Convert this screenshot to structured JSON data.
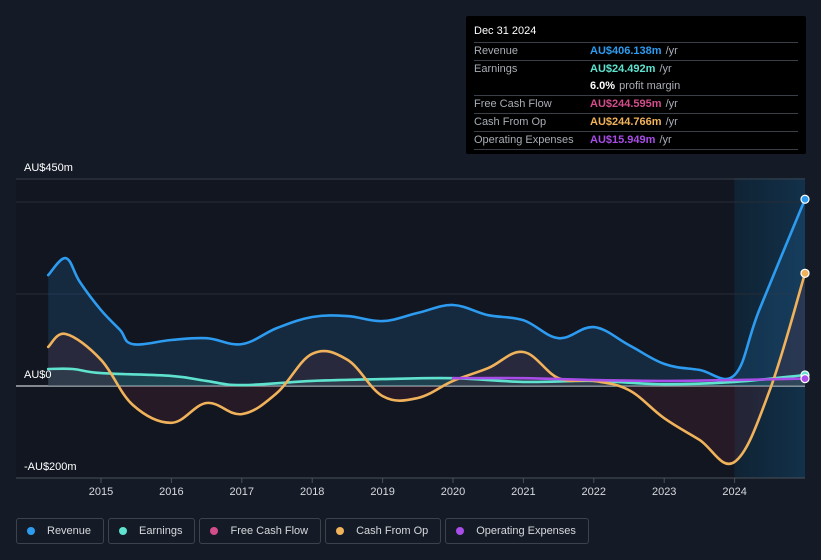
{
  "tooltip": {
    "date": "Dec 31 2024",
    "rows": [
      {
        "label": "Revenue",
        "value": "AU$406.138m",
        "unit": "/yr",
        "color": "#2d9cf0"
      },
      {
        "label": "Earnings",
        "value": "AU$24.492m",
        "unit": "/yr",
        "color": "#5fe3cf"
      },
      {
        "label": "",
        "value": "6.0%",
        "unit": "profit margin",
        "color": "#ffffff"
      },
      {
        "label": "Free Cash Flow",
        "value": "AU$244.595m",
        "unit": "/yr",
        "color": "#d34d8a"
      },
      {
        "label": "Cash From Op",
        "value": "AU$244.766m",
        "unit": "/yr",
        "color": "#f0b25a"
      },
      {
        "label": "Operating Expenses",
        "value": "AU$15.949m",
        "unit": "/yr",
        "color": "#a94de8"
      }
    ]
  },
  "legend": [
    {
      "label": "Revenue",
      "color": "#2d9cf0"
    },
    {
      "label": "Earnings",
      "color": "#5fe3cf"
    },
    {
      "label": "Free Cash Flow",
      "color": "#d34d8a"
    },
    {
      "label": "Cash From Op",
      "color": "#f0b25a"
    },
    {
      "label": "Operating Expenses",
      "color": "#a94de8"
    }
  ],
  "chart_data": {
    "type": "line",
    "title": "",
    "xlabel": "",
    "ylabel": "",
    "ylim": [
      -200,
      450
    ],
    "xlim": [
      2014.25,
      2025.0
    ],
    "y_tick_labels": [
      "AU$450m",
      "AU$0",
      "-AU$200m"
    ],
    "y_gridlines": [
      450,
      400,
      200,
      0
    ],
    "x_tick_labels": [
      "2015",
      "2016",
      "2017",
      "2018",
      "2019",
      "2020",
      "2021",
      "2022",
      "2023",
      "2024"
    ],
    "x_ticks": [
      2015,
      2016,
      2017,
      2018,
      2019,
      2020,
      2021,
      2022,
      2023,
      2024
    ],
    "highlight_range": [
      2024.0,
      2025.0
    ],
    "grid": true,
    "legend_position": "bottom",
    "series": [
      {
        "name": "Revenue",
        "color": "#2d9cf0",
        "fill": true,
        "x": [
          2014.25,
          2014.5,
          2014.7,
          2015.0,
          2015.27,
          2015.45,
          2016.0,
          2016.5,
          2017.0,
          2017.5,
          2018.0,
          2018.5,
          2019.0,
          2019.5,
          2020.0,
          2020.5,
          2021.0,
          2021.5,
          2022.0,
          2022.5,
          2023.0,
          2023.5,
          2024.0,
          2024.35,
          2025.0
        ],
        "values": [
          241,
          278,
          226,
          165,
          122,
          91,
          100,
          104,
          91,
          126,
          150,
          152,
          141,
          159,
          176,
          154,
          143,
          104,
          128,
          89,
          48,
          35,
          24,
          165,
          406
        ]
      },
      {
        "name": "Earnings",
        "color": "#5fe3cf",
        "fill": true,
        "x": [
          2014.25,
          2014.6,
          2015.0,
          2016.0,
          2016.5,
          2017.0,
          2018.0,
          2019.0,
          2020.0,
          2021.0,
          2022.0,
          2023.0,
          2024.0,
          2025.0
        ],
        "values": [
          37,
          37,
          28,
          22,
          11,
          2,
          11,
          15,
          17,
          9,
          11,
          4,
          9,
          24
        ]
      },
      {
        "name": "Free Cash Flow",
        "color": "#d34d8a",
        "fill": true,
        "x": [
          2014.25,
          2014.5,
          2015.0,
          2015.45,
          2016.0,
          2016.5,
          2017.0,
          2017.5,
          2018.0,
          2018.5,
          2019.0,
          2019.5,
          2020.0,
          2020.5,
          2021.0,
          2021.5,
          2022.0,
          2022.5,
          2023.0,
          2023.5,
          2024.0,
          2024.5,
          2025.0
        ],
        "values": [
          85,
          113,
          57,
          -41,
          -80,
          -37,
          -61,
          -15,
          70,
          57,
          -22,
          -26,
          11,
          39,
          74,
          17,
          11,
          -9,
          -70,
          -117,
          -165,
          -9,
          245
        ]
      },
      {
        "name": "Cash From Op",
        "color": "#f0b25a",
        "fill": false,
        "x": [
          2014.25,
          2014.5,
          2015.0,
          2015.45,
          2016.0,
          2016.5,
          2017.0,
          2017.5,
          2018.0,
          2018.5,
          2019.0,
          2019.5,
          2020.0,
          2020.5,
          2021.0,
          2021.5,
          2022.0,
          2022.5,
          2023.0,
          2023.5,
          2024.0,
          2024.5,
          2025.0
        ],
        "values": [
          85,
          113,
          57,
          -41,
          -80,
          -37,
          -61,
          -15,
          70,
          57,
          -22,
          -26,
          11,
          39,
          74,
          17,
          11,
          -9,
          -70,
          -117,
          -165,
          -9,
          245
        ]
      },
      {
        "name": "Operating Expenses",
        "color": "#a94de8",
        "fill": false,
        "x": [
          2020.0,
          2021.0,
          2022.0,
          2023.0,
          2024.0,
          2025.0
        ],
        "values": [
          17,
          17,
          13,
          11,
          13,
          16
        ]
      }
    ]
  }
}
